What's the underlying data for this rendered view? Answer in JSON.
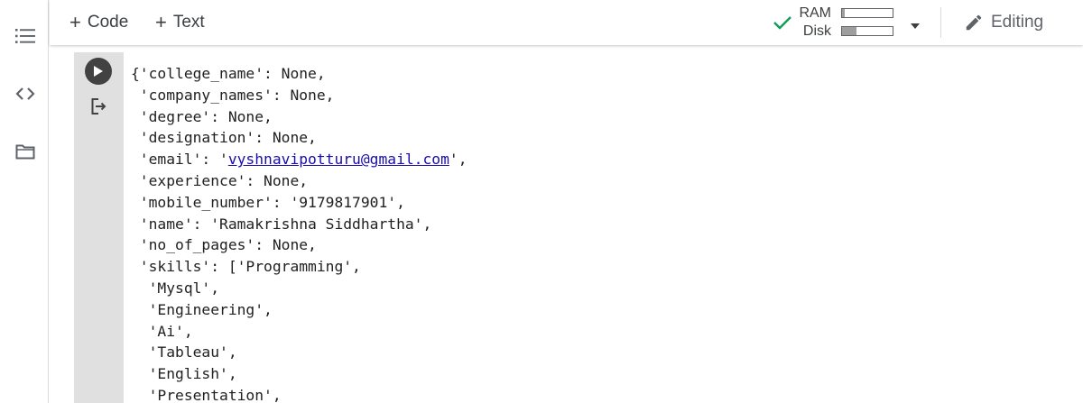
{
  "toolbar": {
    "add_code_label": "Code",
    "add_text_label": "Text",
    "ram_label": "RAM",
    "disk_label": "Disk",
    "ram_usage": 0.05,
    "disk_usage": 0.28,
    "editing_label": "Editing"
  },
  "sidebar": {
    "items": [
      {
        "icon": "table-of-contents-icon"
      },
      {
        "icon": "code-snippets-icon"
      },
      {
        "icon": "files-folder-icon"
      }
    ]
  },
  "cell": {
    "output_lines": [
      {
        "text": "{'college_name': None,"
      },
      {
        "text": " 'company_names': None,"
      },
      {
        "text": " 'degree': None,"
      },
      {
        "text": " 'designation': None,"
      },
      {
        "pre": " 'email': '",
        "link": "vyshnavipotturu@gmail.com",
        "post": "',"
      },
      {
        "text": " 'experience': None,"
      },
      {
        "text": " 'mobile_number': '9179817901',"
      },
      {
        "text": " 'name': 'Ramakrishna Siddhartha',"
      },
      {
        "text": " 'no_of_pages': None,"
      },
      {
        "text": " 'skills': ['Programming',"
      },
      {
        "text": "  'Mysql',"
      },
      {
        "text": "  'Engineering',"
      },
      {
        "text": "  'Ai',"
      },
      {
        "text": "  'Tableau',"
      },
      {
        "text": "  'English',"
      },
      {
        "text": "  'Presentation',"
      }
    ]
  },
  "colors": {
    "check": "#0f9d58",
    "gutter": "#e0e0e0",
    "run_button": "#424242",
    "link": "#1a0dab"
  }
}
